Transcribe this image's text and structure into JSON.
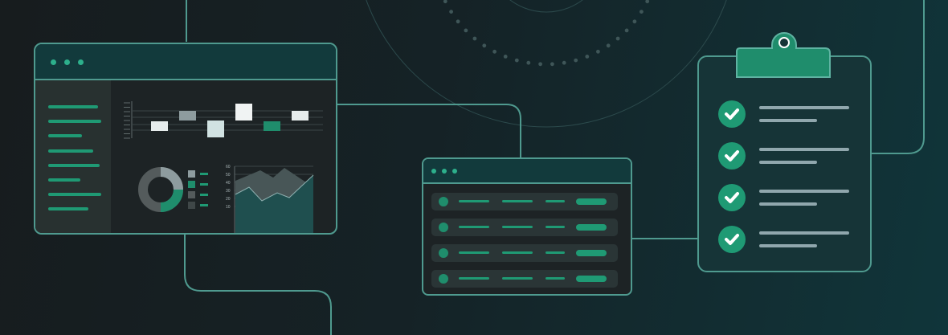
{
  "palette": {
    "background_dark": "#171c1e",
    "background_teal": "#10353a",
    "accent_green": "#1f9a74",
    "outline": "#4f9a8f",
    "panel": "#1d2325",
    "text_line_gray": "#90a7ad"
  },
  "dashboard_window": {
    "title_bar_dots": 3,
    "sidebar_items": 8,
    "bar_chart_bars": 6,
    "donut_legend_items": 4,
    "area_chart_axis_labels": [
      "60",
      "50",
      "40",
      "30",
      "20",
      "10"
    ]
  },
  "list_window": {
    "title_bar_dots": 3,
    "rows": 4
  },
  "clipboard": {
    "checked_items": 4
  },
  "icons": [
    "window-dots-icon",
    "check-icon",
    "clipboard-clip-icon",
    "donut-chart-icon",
    "area-chart-icon"
  ]
}
